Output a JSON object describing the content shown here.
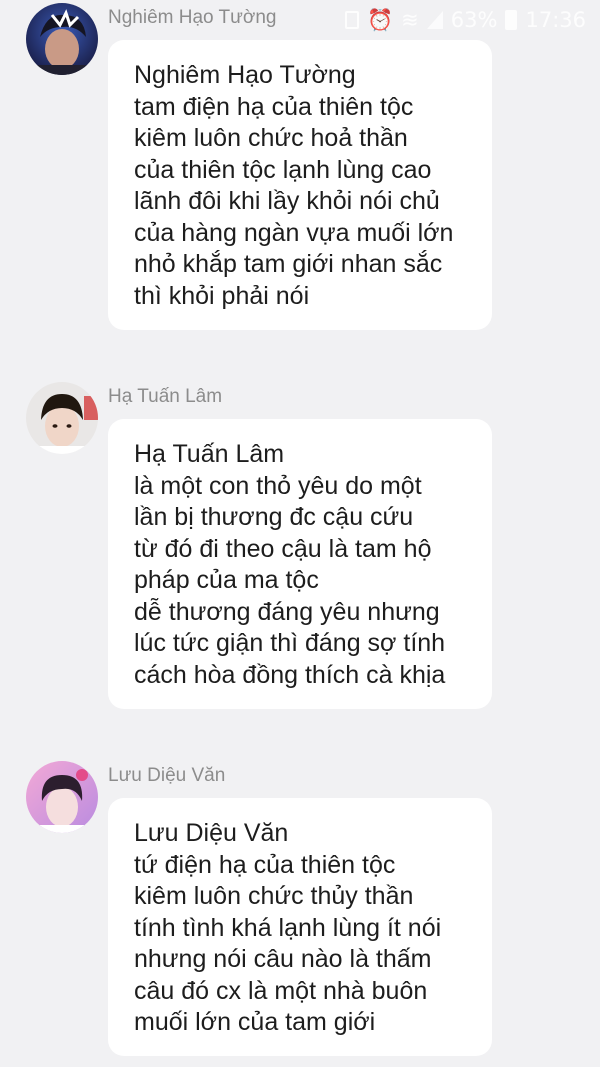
{
  "status_bar": {
    "battery_text": "63%",
    "time": "17:36",
    "icons": [
      "image-icon",
      "alarm-icon",
      "wifi-icon",
      "signal-icon",
      "battery-icon"
    ]
  },
  "messages": [
    {
      "sender": "Nghiêm Hạo Tường",
      "avatar_icon": "avatar-nghiem-hao-tuong",
      "lines": [
        "Nghiêm Hạo Tường",
        "tam điện hạ của thiên tộc",
        "kiêm luôn chức hoả thần",
        "của thiên tộc lạnh lùng cao",
        "lãnh đôi khi lầy khỏi nói chủ",
        "của hàng ngàn vựa muối lớn",
        "nhỏ khắp tam giới nhan sắc",
        "thì khỏi phải nói"
      ]
    },
    {
      "sender": "Hạ Tuấn Lâm",
      "avatar_icon": "avatar-ha-tuan-lam",
      "lines": [
        "Hạ Tuấn Lâm",
        "là một con thỏ yêu do một",
        "lần bị thương đc cậu cứu",
        "từ đó đi theo cậu là tam hộ",
        "pháp của ma tộc",
        "dễ thương đáng yêu nhưng",
        "lúc tức giận thì đáng sợ tính",
        "cách hòa đồng thích cà khịa"
      ]
    },
    {
      "sender": "Lưu Diệu Văn",
      "avatar_icon": "avatar-luu-dieu-van",
      "lines": [
        "Lưu Diệu Văn",
        "tứ điện hạ của thiên tộc",
        "kiêm luôn chức thủy thần",
        "tính tình khá lạnh lùng ít nói",
        "nhưng nói câu nào là thấm",
        "câu đó cx là một nhà buôn",
        "muối lớn của tam giới"
      ]
    }
  ]
}
